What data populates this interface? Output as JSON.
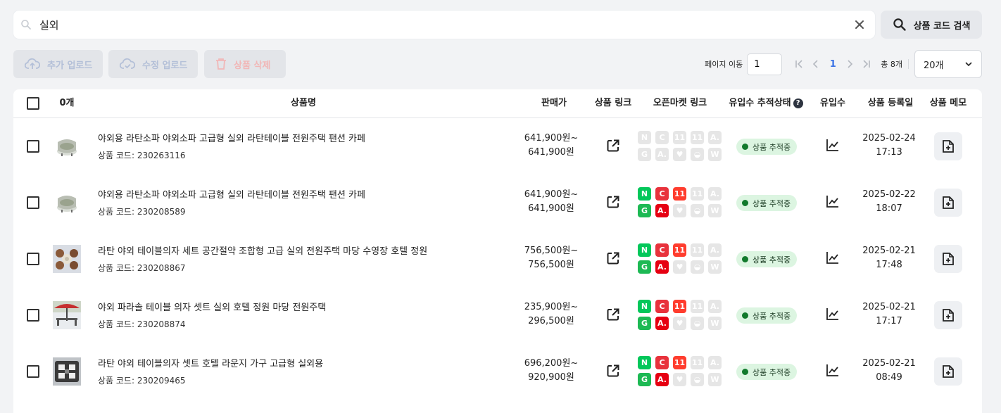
{
  "search": {
    "value": "실외",
    "code_search_label": "상품 코드 검색"
  },
  "toolbar": {
    "add_upload": "추가 업로드",
    "edit_upload": "수정 업로드",
    "delete": "상품 삭제"
  },
  "pager": {
    "move_label": "페이지 이동",
    "page_input": "1",
    "current_page": "1",
    "total": "총 8개",
    "page_size": "20개"
  },
  "table": {
    "headers": {
      "selected_count": "0개",
      "name": "상품명",
      "price": "판매가",
      "product_link": "상품 링크",
      "market_link": "오픈마켓 링크",
      "tracking": "유입수 추적상태",
      "inflow": "유입수",
      "reg_date": "상품 등록일",
      "memo": "상품 메모"
    },
    "rows": [
      {
        "name": "야외용 라탄소파 야외소파 고급형 실외 라탄테이블 전원주택 팬션 카페",
        "code": "상품 코드: 230263116",
        "price_min": "641,900원~",
        "price_max": "641,900원",
        "status": "상품 추적중",
        "date": "2025-02-24",
        "time": "17:13",
        "thumb": "sofa",
        "markets_active": false
      },
      {
        "name": "야외용 라탄소파 야외소파 고급형 실외 라탄테이블 전원주택 팬션 카페",
        "code": "상품 코드: 230208589",
        "price_min": "641,900원~",
        "price_max": "641,900원",
        "status": "상품 추적중",
        "date": "2025-02-22",
        "time": "18:07",
        "thumb": "sofa",
        "markets_active": true
      },
      {
        "name": "라탄 야외 테이블의자 세트 공간절약 조합형 고급 실외 전원주택 마당 수영장 호텔 정원",
        "code": "상품 코드: 230208867",
        "price_min": "756,500원~",
        "price_max": "756,500원",
        "status": "상품 추적중",
        "date": "2025-02-21",
        "time": "17:48",
        "thumb": "table-set",
        "markets_active": true
      },
      {
        "name": "야외 파라솔 테이블 의자 셋트 실외 호텔 정원 마당 전원주택",
        "code": "상품 코드: 230208874",
        "price_min": "235,900원~",
        "price_max": "296,500원",
        "status": "상품 추적중",
        "date": "2025-02-21",
        "time": "17:17",
        "thumb": "parasol",
        "markets_active": true
      },
      {
        "name": "라탄 야외 테이블의자 셋트 호텔 라운지 가구 고급형 실외용",
        "code": "상품 코드: 230209465",
        "price_min": "696,200원~",
        "price_max": "920,900원",
        "status": "상품 추적중",
        "date": "2025-02-21",
        "time": "08:49",
        "thumb": "lounge",
        "markets_active": true
      }
    ]
  },
  "markets": {
    "top": [
      {
        "icon": "naver-n-icon",
        "glyph": "N",
        "color": "#03c75a"
      },
      {
        "icon": "coupang-c-icon",
        "glyph": "C",
        "color": "#e8323c"
      },
      {
        "icon": "11st-icon",
        "glyph": "11",
        "color": "#ff3d2e"
      },
      {
        "icon": "11st-alt-icon",
        "glyph": "11",
        "color": "#e6e6e6"
      },
      {
        "icon": "auction-icon",
        "glyph": "A.",
        "color": "#e6e6e6"
      }
    ],
    "bottom": [
      {
        "icon": "gmarket-g-icon",
        "glyph": "G",
        "color": "#1db954"
      },
      {
        "icon": "auction-a-icon",
        "glyph": "A.",
        "color": "#e60012"
      },
      {
        "icon": "heart-icon",
        "glyph": "♥",
        "color": "#e6e6e6"
      },
      {
        "icon": "ghost-icon",
        "glyph": "◒",
        "color": "#e6e6e6"
      },
      {
        "icon": "wemakeprice-w-icon",
        "glyph": "W",
        "color": "#e6e6e6"
      }
    ]
  }
}
